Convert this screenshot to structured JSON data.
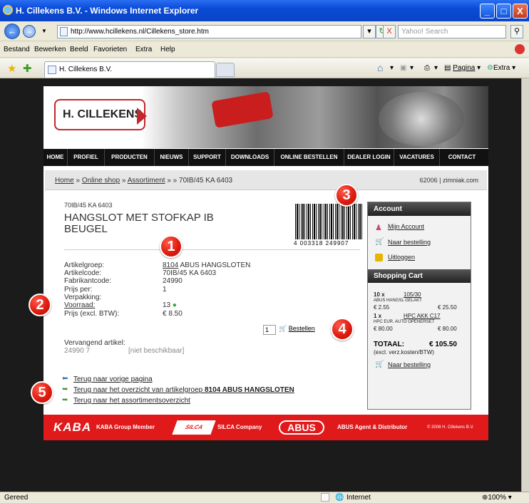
{
  "window": {
    "title": "H. Cillekens B.V. - Windows Internet Explorer",
    "min": "_",
    "max": "□",
    "close": "X"
  },
  "address": {
    "back": "←",
    "forward": "→",
    "url": "http://www.hcillekens.nl/Cillekens_store.htm",
    "refresh": "↻",
    "stop": "X",
    "search_placeholder": "Yahoo! Search"
  },
  "menu": [
    "Bestand",
    "Bewerken",
    "Beeld",
    "Favorieten",
    "Extra",
    "Help"
  ],
  "favbar": {
    "tab_label": "H. Cillekens B.V.",
    "pagina": "Pagina",
    "extra": "Extra"
  },
  "site": {
    "logo": "H. CILLEKENS",
    "nav": [
      "HOME",
      "PROFIEL",
      "PRODUCTEN",
      "NIEUWS",
      "SUPPORT",
      "DOWNLOADS",
      "ONLINE BESTELLEN",
      "DEALER LOGIN",
      "VACATURES",
      "CONTACT"
    ],
    "breadcrumb": {
      "home": "Home",
      "shop": "Online shop",
      "assortiment": "Assortiment",
      "rest": " » » 70IB/45 KA 6403",
      "sep": " » ",
      "right": "62006 | zimniak.com"
    },
    "product": {
      "code": "70IB/45 KA 6403",
      "title": "HANGSLOT MET STOFKAP IB BEUGEL",
      "barcode": "4 003318 249907",
      "fields": [
        {
          "label": "Artikelgroep:",
          "value_link": "8104",
          "value": " ABUS HANGSLOTEN"
        },
        {
          "label": "Artikelcode:",
          "value": "70IB/45 KA 6403"
        },
        {
          "label": "Fabrikantcode:",
          "value": "24990"
        },
        {
          "label": "Prijs per:",
          "value": "1"
        },
        {
          "label": "Verpakking:",
          "value": ""
        },
        {
          "label": "Voorraad:",
          "value": "13"
        },
        {
          "label": "Prijs (excl. BTW):",
          "value": "€ 8.50"
        }
      ],
      "qty": "1",
      "order": "Bestellen",
      "replacement_label": "Vervangend artikel:",
      "replacement_code": "24990 7",
      "replacement_status": "[niet beschikbaar]"
    },
    "account": {
      "title": "Account",
      "links": [
        "Mijn Account",
        "Naar bestelling",
        "Uitloggen"
      ]
    },
    "cart": {
      "title": "Shopping Cart",
      "items": [
        {
          "qty": "10 x",
          "code": "105/30",
          "desc": "ABUS HANGSL GELAKT",
          "unit": "€ 2.55",
          "total": "€ 25.50"
        },
        {
          "qty": "1 x",
          "code": "HPC AKK C17",
          "desc": "HPC EUR. AUTO OPENERSET",
          "unit": "€ 80.00",
          "total": "€ 80.00"
        }
      ],
      "total_label": "TOTAAL:",
      "total_value": "€ 105.50",
      "total_note": "(excl. verz.kosten/BTW)",
      "checkout": "Naar bestelling"
    },
    "back_links": [
      {
        "text": "Terug naar vorige pagina",
        "bold": ""
      },
      {
        "text": "Terug naar het overzicht van artikelgroep ",
        "bold": "8104 ABUS HANGSLOTEN"
      },
      {
        "text": "Terug naar het assortimentsoverzicht",
        "bold": ""
      }
    ],
    "footer": {
      "kaba": "KABA",
      "kaba_member": "KABA Group Member",
      "silca_logo": "SILCA",
      "silca_company": "SILCA Company",
      "abus": "ABUS",
      "abus_agent": "ABUS Agent & Distributor",
      "copy": "© 2008 H. Cillekens B.V."
    }
  },
  "badges": [
    "1",
    "2",
    "3",
    "4",
    "5"
  ],
  "status": {
    "left": "Gereed",
    "zone": "Internet",
    "zoom": "100%"
  }
}
